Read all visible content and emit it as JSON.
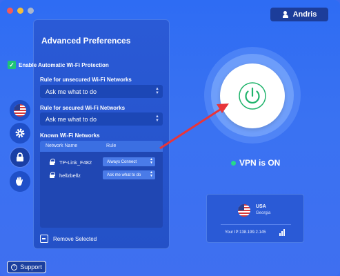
{
  "user": {
    "name": "Andris"
  },
  "prefs": {
    "title": "Advanced Preferences",
    "auto_wifi_label": "Enable Automatic Wi-Fi Protection",
    "auto_wifi_checked": true,
    "unsecured_label": "Rule for unsecured Wi-Fi Networks",
    "unsecured_value": "Ask me what to do",
    "secured_label": "Rule for secured Wi-Fi Networks",
    "secured_value": "Ask me what to do",
    "known_label": "Known Wi-Fi Networks",
    "table": {
      "col_name": "Network Name",
      "col_rule": "Rule",
      "rows": [
        {
          "name": "TP-Link_F482",
          "rule": "Always Connect"
        },
        {
          "name": "hellzbellz",
          "rule": "Ask me what to do"
        }
      ]
    },
    "remove_label": "Remove Selected"
  },
  "vpn": {
    "status": "VPN is ON",
    "status_color": "#27d98a"
  },
  "location": {
    "country": "USA",
    "region": "Georgia",
    "ip_text": "Your IP:138.199.2.145"
  },
  "support_label": "Support",
  "colors": {
    "accent": "#1fc477",
    "background": "#3a6bf0",
    "arrow": "#e8353a"
  },
  "icons": {
    "user": "user-icon",
    "power": "power-icon",
    "lock": "lock-icon",
    "settings": "gear-icon",
    "hand": "hand-icon",
    "flag": "us-flag-icon",
    "signal": "signal-icon",
    "support": "question-icon"
  }
}
